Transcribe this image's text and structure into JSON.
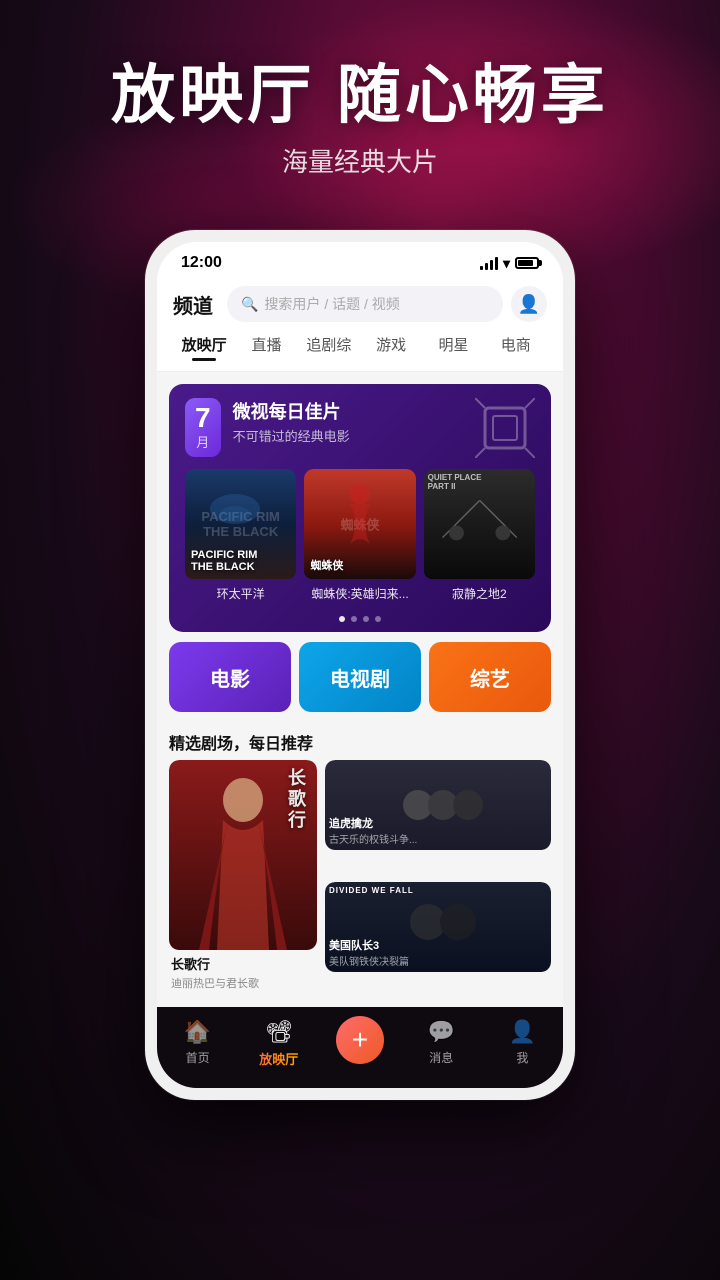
{
  "app": {
    "title": "放映厅 随心畅享",
    "subtitle": "海量经典大片"
  },
  "phone": {
    "status_bar": {
      "time": "12:00"
    },
    "nav": {
      "title": "频道",
      "search_placeholder": "搜索用户 / 话题 / 视频"
    },
    "tabs": [
      {
        "label": "放映厅",
        "active": true
      },
      {
        "label": "直播",
        "active": false
      },
      {
        "label": "追剧综",
        "active": false
      },
      {
        "label": "游戏",
        "active": false
      },
      {
        "label": "明星",
        "active": false
      },
      {
        "label": "电商",
        "active": false
      }
    ],
    "banner": {
      "date_number": "7",
      "date_unit": "月",
      "title": "微视每日佳片",
      "subtitle": "不可错过的经典电影"
    },
    "movies": [
      {
        "title": "环太平洋",
        "overlay": "PACIFIC RIM\nTHE BLACK"
      },
      {
        "title": "蜘蛛侠:英雄归来...",
        "overlay": "蜘蛛侠"
      },
      {
        "title": "寂静之地2",
        "overlay": ""
      }
    ],
    "categories": [
      {
        "label": "电影",
        "type": "movie"
      },
      {
        "label": "电视剧",
        "type": "tv"
      },
      {
        "label": "综艺",
        "type": "variety"
      }
    ],
    "section_title": "精选剧场，每日推荐",
    "dramas": [
      {
        "title": "长歌行",
        "desc": "迪丽热巴与君长歌",
        "size": "large"
      },
      {
        "title": "追虎擒龙",
        "desc": "古天乐的权钱斗争...",
        "size": "small"
      },
      {
        "title": "美国队长3",
        "desc": "美队钢铁侠决裂篇",
        "size": "small"
      }
    ],
    "bottom_nav": [
      {
        "label": "首页",
        "active": false
      },
      {
        "label": "放映厅",
        "active": true,
        "highlight": true
      },
      {
        "label": "+",
        "type": "plus"
      },
      {
        "label": "消息",
        "active": false
      },
      {
        "label": "我",
        "active": false
      }
    ]
  }
}
